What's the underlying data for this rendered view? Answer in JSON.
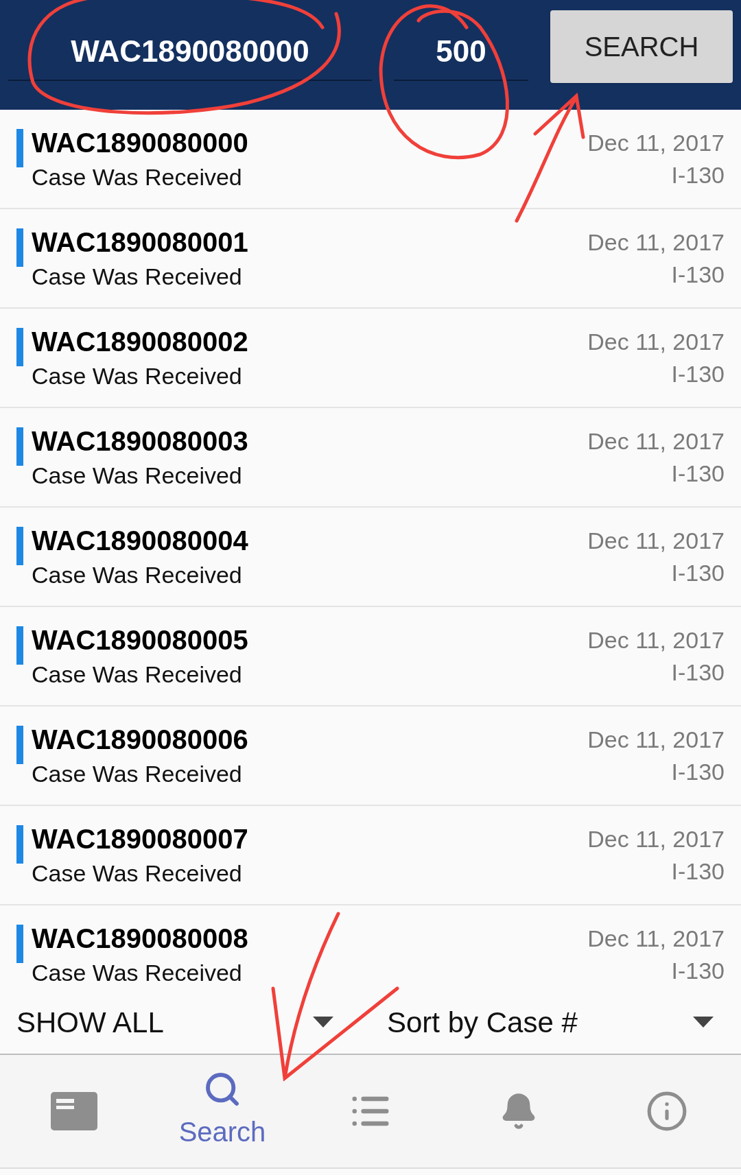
{
  "search_bar": {
    "receipt_field": {
      "value": "WAC1890080000"
    },
    "count_field": {
      "value": "500"
    },
    "button": "SEARCH"
  },
  "cases": [
    {
      "case_number": "WAC1890080000",
      "status": "Case Was Received",
      "date": "Dec 11, 2017",
      "form": "I-130",
      "color": "#1e88e5"
    },
    {
      "case_number": "WAC1890080001",
      "status": "Case Was Received",
      "date": "Dec 11, 2017",
      "form": "I-130",
      "color": "#1e88e5"
    },
    {
      "case_number": "WAC1890080002",
      "status": "Case Was Received",
      "date": "Dec 11, 2017",
      "form": "I-130",
      "color": "#1e88e5"
    },
    {
      "case_number": "WAC1890080003",
      "status": "Case Was Received",
      "date": "Dec 11, 2017",
      "form": "I-130",
      "color": "#1e88e5"
    },
    {
      "case_number": "WAC1890080004",
      "status": "Case Was Received",
      "date": "Dec 11, 2017",
      "form": "I-130",
      "color": "#1e88e5"
    },
    {
      "case_number": "WAC1890080005",
      "status": "Case Was Received",
      "date": "Dec 11, 2017",
      "form": "I-130",
      "color": "#1e88e5"
    },
    {
      "case_number": "WAC1890080006",
      "status": "Case Was Received",
      "date": "Dec 11, 2017",
      "form": "I-130",
      "color": "#1e88e5"
    },
    {
      "case_number": "WAC1890080007",
      "status": "Case Was Received",
      "date": "Dec 11, 2017",
      "form": "I-130",
      "color": "#1e88e5"
    },
    {
      "case_number": "WAC1890080008",
      "status": "Case Was Received",
      "date": "Dec 11, 2017",
      "form": "I-130",
      "color": "#1e88e5"
    }
  ],
  "filters": {
    "show": "SHOW ALL",
    "sort": "Sort by Case #"
  },
  "bottom_nav": [
    {
      "kind": "card",
      "selected": false
    },
    {
      "kind": "search",
      "label": "Search",
      "selected": true
    },
    {
      "kind": "list",
      "selected": false
    },
    {
      "kind": "bell",
      "selected": false
    },
    {
      "kind": "info",
      "selected": false
    }
  ]
}
